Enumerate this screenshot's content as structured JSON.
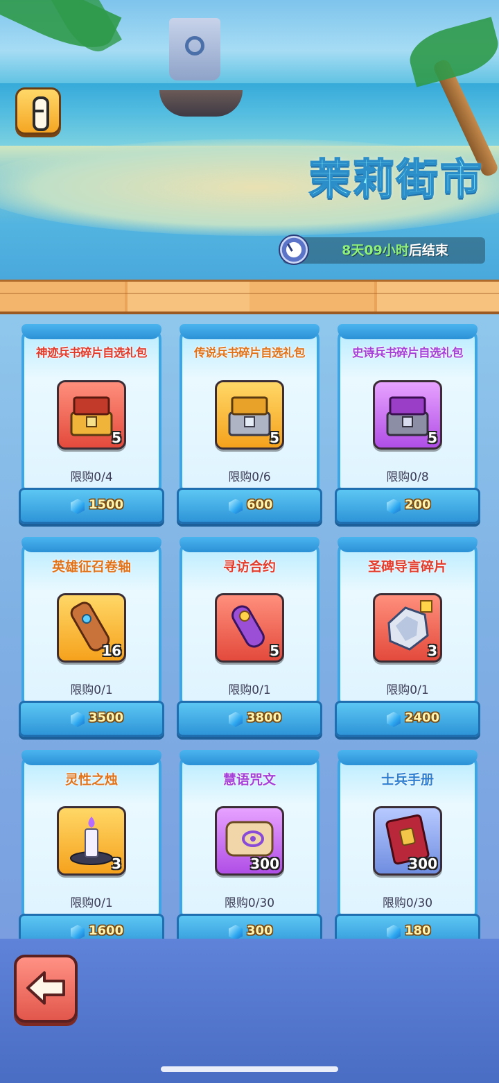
{
  "header": {
    "title": "茉莉街市",
    "timer": {
      "highlight": "8天09小时",
      "suffix": "后结束"
    }
  },
  "shop": {
    "items": [
      {
        "name": "神迹兵书碎片自选礼包",
        "name_color": "#e23b2b",
        "icon": "red-chest-icon",
        "icon_bg": "red",
        "qty": "5",
        "limit": "限购0/4",
        "price": "1500"
      },
      {
        "name": "传说兵书碎片自选礼包",
        "name_color": "#e0731a",
        "icon": "gold-chest-icon",
        "icon_bg": "gold",
        "qty": "5",
        "limit": "限购0/6",
        "price": "600"
      },
      {
        "name": "史诗兵书碎片自选礼包",
        "name_color": "#a43fd8",
        "icon": "purple-chest-icon",
        "icon_bg": "purple",
        "qty": "5",
        "limit": "限购0/8",
        "price": "200"
      },
      {
        "name": "英雄征召卷轴",
        "name_color": "#e0731a",
        "icon": "hero-scroll-icon",
        "icon_bg": "gold",
        "qty": "16",
        "limit": "限购0/1",
        "price": "3500"
      },
      {
        "name": "寻访合约",
        "name_color": "#e23b2b",
        "icon": "contract-scroll-icon",
        "icon_bg": "red",
        "qty": "5",
        "limit": "限购0/1",
        "price": "3800"
      },
      {
        "name": "圣碑导言碎片",
        "name_color": "#e23b2b",
        "icon": "stele-fragment-icon",
        "icon_bg": "red",
        "qty": "3",
        "limit": "限购0/1",
        "price": "2400"
      },
      {
        "name": "灵性之烛",
        "name_color": "#e0731a",
        "icon": "candle-icon",
        "icon_bg": "gold",
        "qty": "3",
        "limit": "限购0/1",
        "price": "1600"
      },
      {
        "name": "慧语咒文",
        "name_color": "#a43fd8",
        "icon": "spell-scroll-icon",
        "icon_bg": "purple",
        "qty": "300",
        "limit": "限购0/30",
        "price": "300"
      },
      {
        "name": "士兵手册",
        "name_color": "#2f7fd0",
        "icon": "soldier-manual-icon",
        "icon_bg": "blue",
        "qty": "300",
        "limit": "限购0/30",
        "price": "180"
      }
    ]
  }
}
